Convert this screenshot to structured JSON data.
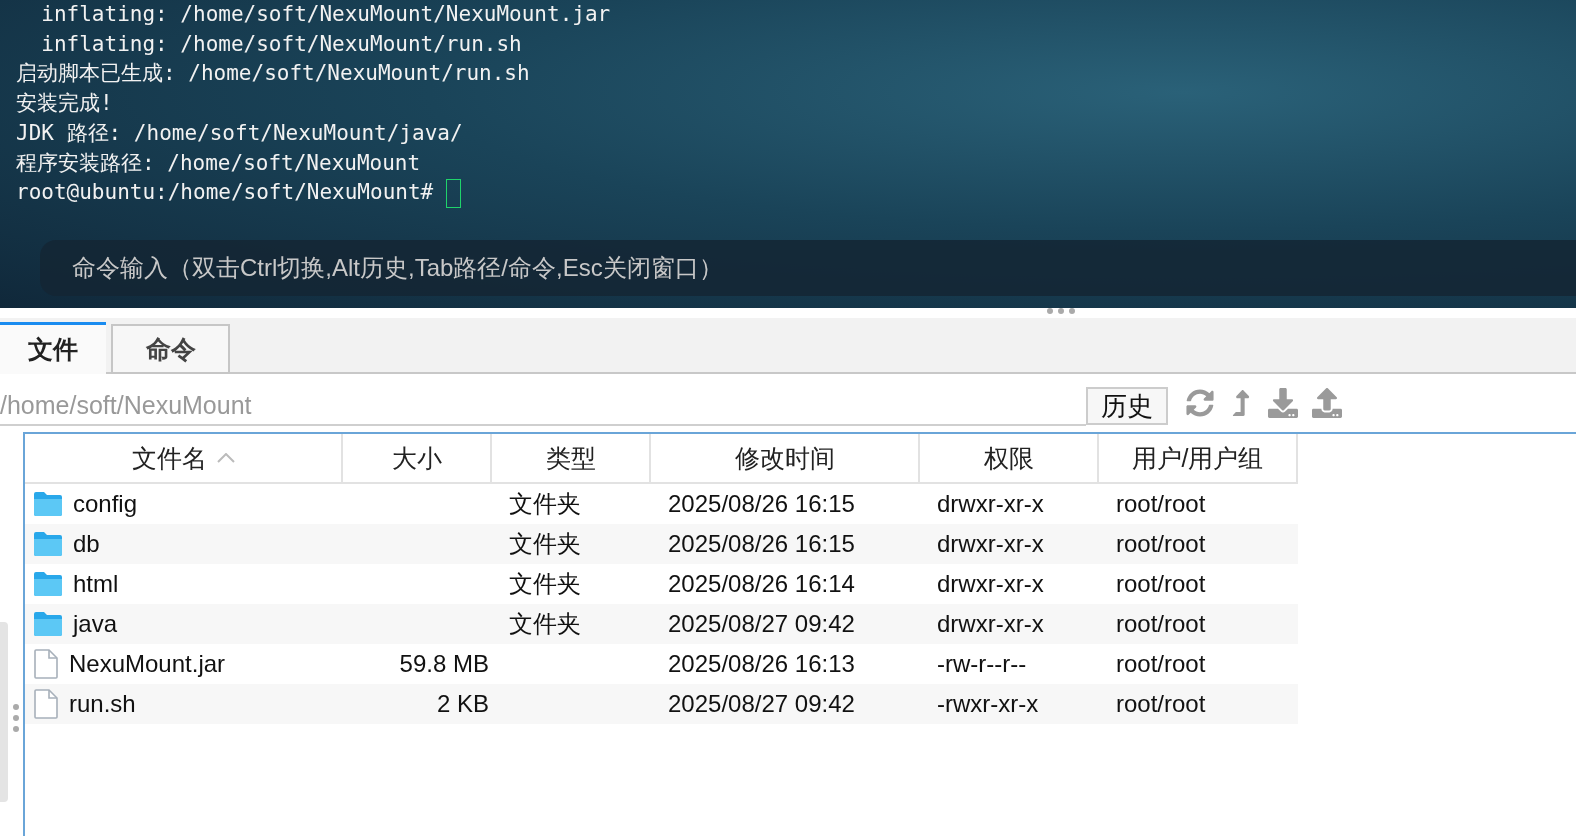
{
  "terminal": {
    "lines": [
      "  inflating: /home/soft/NexuMount/NexuMount.jar",
      "  inflating: /home/soft/NexuMount/run.sh",
      "启动脚本已生成: /home/soft/NexuMount/run.sh",
      "安装完成!",
      "JDK 路径: /home/soft/NexuMount/java/",
      "程序安装路径: /home/soft/NexuMount",
      "root@ubuntu:/home/soft/NexuMount# "
    ],
    "command_input": {
      "placeholder": "命令输入（双击Ctrl切换,Alt历史,Tab路径/命令,Esc关闭窗口）"
    }
  },
  "tabs": [
    {
      "label": "文件",
      "selected": true
    },
    {
      "label": "命令",
      "selected": false
    }
  ],
  "path_bar": {
    "value": "/home/soft/NexuMount",
    "history_button": "历史"
  },
  "table": {
    "columns": [
      {
        "label": "文件名",
        "sorted": true
      },
      {
        "label": "大小",
        "sorted": false
      },
      {
        "label": "类型",
        "sorted": false
      },
      {
        "label": "修改时间",
        "sorted": false
      },
      {
        "label": "权限",
        "sorted": false
      },
      {
        "label": "用户/用户组",
        "sorted": false
      }
    ],
    "rows": [
      {
        "kind": "folder",
        "name": "config",
        "size": "",
        "type": "文件夹",
        "modified": "2025/08/26 16:15",
        "permissions": "drwxr-xr-x",
        "owner": "root/root"
      },
      {
        "kind": "folder",
        "name": "db",
        "size": "",
        "type": "文件夹",
        "modified": "2025/08/26 16:15",
        "permissions": "drwxr-xr-x",
        "owner": "root/root"
      },
      {
        "kind": "folder",
        "name": "html",
        "size": "",
        "type": "文件夹",
        "modified": "2025/08/26 16:14",
        "permissions": "drwxr-xr-x",
        "owner": "root/root"
      },
      {
        "kind": "folder",
        "name": "java",
        "size": "",
        "type": "文件夹",
        "modified": "2025/08/27 09:42",
        "permissions": "drwxr-xr-x",
        "owner": "root/root"
      },
      {
        "kind": "file",
        "name": "NexuMount.jar",
        "size": "59.8 MB",
        "type": "",
        "modified": "2025/08/26 16:13",
        "permissions": "-rw-r--r--",
        "owner": "root/root"
      },
      {
        "kind": "file",
        "name": "run.sh",
        "size": "2 KB",
        "type": "",
        "modified": "2025/08/27 09:42",
        "permissions": "-rwxr-xr-x",
        "owner": "root/root"
      }
    ]
  }
}
